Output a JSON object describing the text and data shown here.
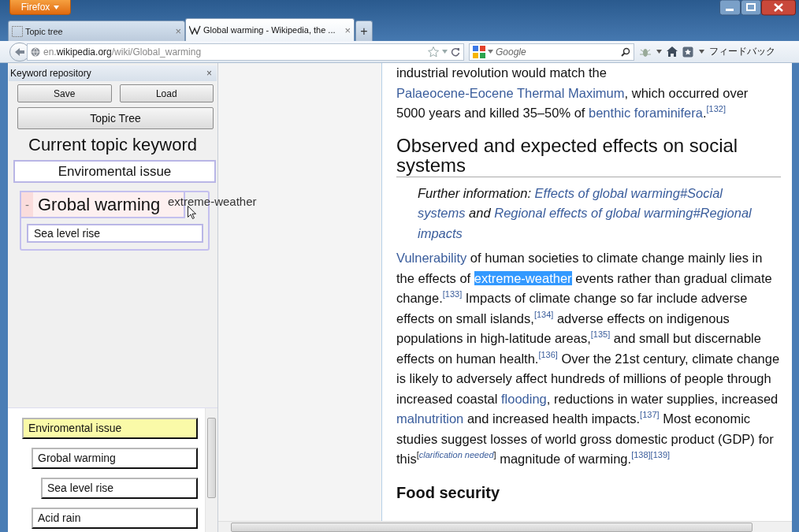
{
  "window": {
    "menu_button": "Firefox"
  },
  "tabs": [
    {
      "title": "Topic tree",
      "close": "×",
      "selected": false
    },
    {
      "title": "Global warming - Wikipedia, the ...",
      "close": "×",
      "selected": true
    }
  ],
  "new_tab": "+",
  "address": {
    "url": "en.**wikipedia.org**/wiki/Global_warming"
  },
  "search": {
    "placeholder": "Google"
  },
  "toolbar": {
    "feedback": "フィードバック"
  },
  "sidebar": {
    "title": "Keyword repository",
    "close": "×",
    "buttons": [
      "Save",
      "Load"
    ],
    "topic_tree_button": "Topic Tree",
    "current_heading": "Current topic keyword",
    "current_keyword": "Enviromental issue",
    "group": {
      "toggle": "-",
      "label": "Grobal warming",
      "children": [
        "Sea level rise"
      ]
    },
    "drag_label": "extreme-weather",
    "tree": [
      {
        "label": "Enviromental issue",
        "selected": true,
        "children": [
          {
            "label": "Grobal warming",
            "selected": false,
            "children": [
              {
                "label": "Sea level rise",
                "selected": false
              }
            ]
          },
          {
            "label": "Acid rain",
            "selected": false
          }
        ]
      }
    ]
  },
  "article": {
    "intro": [
      {
        "kind": "text",
        "text": "industrial revolution would match the "
      },
      {
        "kind": "link",
        "text": "Palaeocene-Eocene Thermal"
      },
      {
        "kind": "link",
        "text": "Maximum"
      },
      {
        "kind": "text",
        "text": ", which occurred over 5000 years and killed 35–50% of "
      },
      {
        "kind": "link",
        "text": "benthic foraminifera"
      },
      {
        "kind": "text",
        "text": "."
      },
      {
        "kind": "ref",
        "text": "[132]"
      }
    ],
    "heading": "Observed and expected effects on social systems",
    "hatnote": [
      {
        "kind": "text",
        "text": "Further information: "
      },
      {
        "kind": "link",
        "text": "Effects of global warming#Social"
      },
      {
        "kind": "link",
        "text": "systems"
      },
      {
        "kind": "text",
        "text": " and "
      },
      {
        "kind": "link",
        "text": "Regional effects of global warming#Regional"
      },
      {
        "kind": "link",
        "text": "impacts"
      }
    ],
    "paragraph": [
      {
        "kind": "link",
        "text": "Vulnerability"
      },
      {
        "kind": "text",
        "text": " of human societies to climate change mainly lies in the effects of "
      },
      {
        "kind": "selected",
        "text": "extreme-weather"
      },
      {
        "kind": "text",
        "text": " events rather than gradual climate change."
      },
      {
        "kind": "ref",
        "text": "[133]"
      },
      {
        "kind": "text",
        "text": " Impacts of climate change so far include adverse effects on small islands,"
      },
      {
        "kind": "ref",
        "text": "[134]"
      },
      {
        "kind": "text",
        "text": " adverse effects on indigenous populations in high-latitude areas,"
      },
      {
        "kind": "ref",
        "text": "[135]"
      },
      {
        "kind": "text",
        "text": " and small but discernable effects on human health."
      },
      {
        "kind": "ref",
        "text": "[136]"
      },
      {
        "kind": "text",
        "text": " Over the 21st century, climate change is likely to adversely affect hundreds of millions of people through increased coastal "
      },
      {
        "kind": "link",
        "text": "flooding"
      },
      {
        "kind": "text",
        "text": ", reductions in water supplies, increased "
      },
      {
        "kind": "link",
        "text": "malnutrition"
      },
      {
        "kind": "text",
        "text": " and increased health impacts."
      },
      {
        "kind": "ref",
        "text": "[137]"
      },
      {
        "kind": "text",
        "text": " Most economic studies suggest losses of world gross domestic product (GDP) for this"
      },
      {
        "kind": "sup",
        "text": "["
      },
      {
        "kind": "note",
        "text": "clarification needed"
      },
      {
        "kind": "sup",
        "text": "]"
      },
      {
        "kind": "text",
        "text": " magnitude of warming."
      },
      {
        "kind": "ref",
        "text": "[138]"
      },
      {
        "kind": "ref",
        "text": "[139]"
      }
    ],
    "subheading": "Food security"
  }
}
